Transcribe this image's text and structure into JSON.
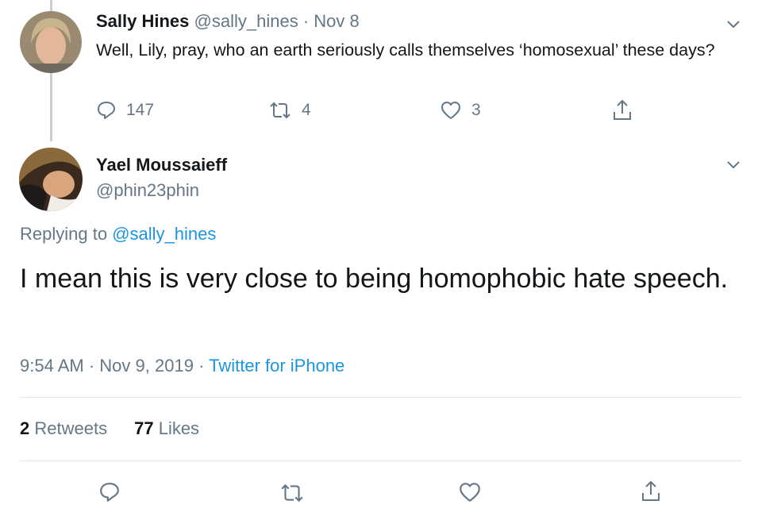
{
  "parent_tweet": {
    "name": "Sally Hines",
    "handle": "@sally_hines",
    "separator": "·",
    "date": "Nov 8",
    "text": "Well, Lily, pray, who an earth seriously calls themselves ‘homosexual’ these days?",
    "replies": "147",
    "retweets": "4",
    "likes": "3"
  },
  "main_tweet": {
    "name": "Yael Moussaieff",
    "handle": "@phin23phin",
    "replying_prefix": "Replying to",
    "replying_to": "@sally_hines",
    "text": "I mean this is very close to being homophobic hate speech.",
    "time": "9:54 AM",
    "sep1": "·",
    "date": "Nov 9, 2019",
    "sep2": "·",
    "source": "Twitter for iPhone",
    "retweet_count": "2",
    "retweet_label": "Retweets",
    "like_count": "77",
    "like_label": "Likes"
  },
  "icons": {
    "reply": "reply-icon",
    "retweet": "retweet-icon",
    "like": "heart-icon",
    "share": "share-icon",
    "menu": "chevron-down-icon"
  },
  "colors": {
    "text": "#14171a",
    "muted": "#657786",
    "link": "#1b95e0",
    "divider": "#e1e8ed",
    "thread_line": "#c4cfd6"
  }
}
